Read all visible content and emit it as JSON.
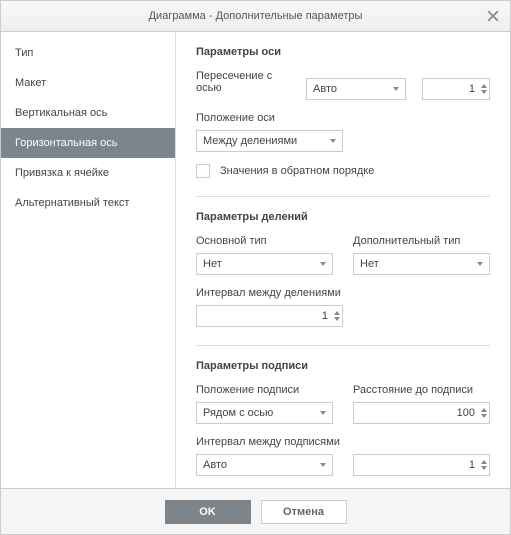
{
  "title": "Диаграмма - Дополнительные параметры",
  "sidebar": {
    "items": [
      {
        "label": "Тип"
      },
      {
        "label": "Макет"
      },
      {
        "label": "Вертикальная ось"
      },
      {
        "label": "Горизонтальная ось"
      },
      {
        "label": "Привязка к ячейке"
      },
      {
        "label": "Альтернативный текст"
      }
    ],
    "active_index": 3
  },
  "axis_options": {
    "title": "Параметры оси",
    "crosses_label": "Пересечение с осью",
    "crosses_value": "Авто",
    "crosses_number": "1",
    "position_label": "Положение оси",
    "position_value": "Между делениями",
    "reverse_label": "Значения в обратном порядке"
  },
  "tick_options": {
    "title": "Параметры делений",
    "major_label": "Основной тип",
    "major_value": "Нет",
    "minor_label": "Дополнительный тип",
    "minor_value": "Нет",
    "interval_label": "Интервал между делениями",
    "interval_value": "1"
  },
  "label_options": {
    "title": "Параметры подписи",
    "position_label": "Положение подписи",
    "position_value": "Рядом с осью",
    "distance_label": "Расстояние до подписи",
    "distance_value": "100",
    "interval_label": "Интервал между подписями",
    "interval_mode": "Авто",
    "interval_value": "1"
  },
  "footer": {
    "ok": "OK",
    "cancel": "Отмена"
  }
}
